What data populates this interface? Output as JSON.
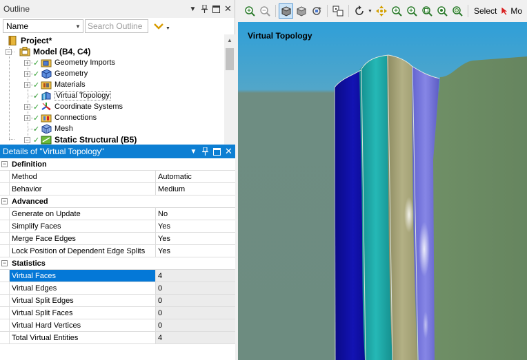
{
  "outline": {
    "title": "Outline",
    "filter_field": "Name",
    "search_placeholder": "Search Outline",
    "tree": [
      {
        "label": "Project*",
        "bold": true
      },
      {
        "label": "Model (B4, C4)",
        "bold": true
      },
      {
        "label": "Geometry Imports"
      },
      {
        "label": "Geometry"
      },
      {
        "label": "Materials"
      },
      {
        "label": "Virtual Topology"
      },
      {
        "label": "Coordinate Systems"
      },
      {
        "label": "Connections"
      },
      {
        "label": "Mesh"
      },
      {
        "label": "Static Structural (B5)",
        "bold": true
      }
    ]
  },
  "details": {
    "title": "Details of \"Virtual Topology\"",
    "sections": [
      {
        "name": "Definition",
        "rows": [
          {
            "key": "Method",
            "value": "Automatic"
          },
          {
            "key": "Behavior",
            "value": "Medium"
          }
        ]
      },
      {
        "name": "Advanced",
        "rows": [
          {
            "key": "Generate on Update",
            "value": "No"
          },
          {
            "key": "Simplify Faces",
            "value": "Yes"
          },
          {
            "key": "Merge Face Edges",
            "value": "Yes"
          },
          {
            "key": "Lock Position of Dependent Edge Splits",
            "value": "Yes"
          }
        ]
      },
      {
        "name": "Statistics",
        "rows": [
          {
            "key": "Virtual Faces",
            "value": "4"
          },
          {
            "key": "Virtual Edges",
            "value": "0"
          },
          {
            "key": "Virtual Split Edges",
            "value": "0"
          },
          {
            "key": "Virtual Split Faces",
            "value": "0"
          },
          {
            "key": "Virtual Hard Vertices",
            "value": "0"
          },
          {
            "key": "Total Virtual Entities",
            "value": "4"
          }
        ]
      }
    ]
  },
  "viewport": {
    "title": "Virtual Topology",
    "colors": {
      "background": "#6e8d82",
      "face_right": "#6b8a63",
      "band_blue": "#0e0e9e",
      "band_teal": "#1aa6a6",
      "band_tan": "#a3a075",
      "band_violet": "#7474dd"
    }
  },
  "toolbar": {
    "select_label": "Select",
    "mode_label": "Mo"
  }
}
